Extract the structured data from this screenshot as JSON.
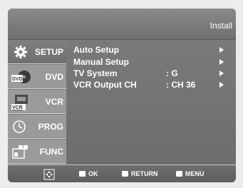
{
  "header": {
    "title": "Install"
  },
  "sidebar": {
    "items": [
      {
        "label": "SETUP",
        "icon": "gear-icon",
        "active": true
      },
      {
        "label": "DVD",
        "icon": "dvd-disc-icon",
        "badge": "DVD"
      },
      {
        "label": "VCR",
        "icon": "vcr-cassette-icon",
        "badge": "VCR"
      },
      {
        "label": "PROG",
        "icon": "clock-icon"
      },
      {
        "label": "FUNC",
        "icon": "function-blocks-icon"
      }
    ]
  },
  "menu": {
    "rows": [
      {
        "label": "Auto Setup",
        "value": ""
      },
      {
        "label": "Manual Setup",
        "value": ""
      },
      {
        "label": "TV System",
        "value": ": G"
      },
      {
        "label": "VCR Output CH",
        "value": ": CH 36"
      }
    ]
  },
  "footer": {
    "nav_icon": "directional-pad-icon",
    "ok_label": "OK",
    "return_label": "RETURN",
    "menu_label": "MENU"
  }
}
